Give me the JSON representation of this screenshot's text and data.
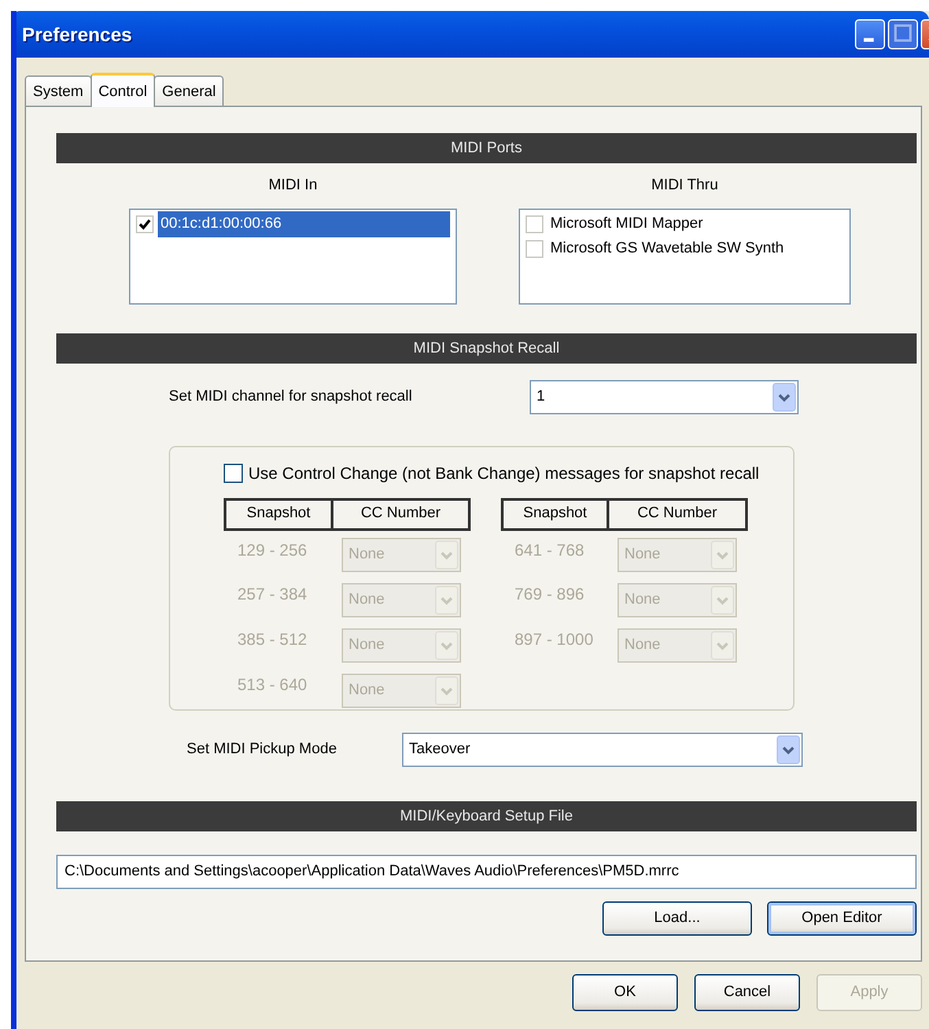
{
  "window": {
    "title": "Preferences"
  },
  "tabs": [
    {
      "label": "System",
      "selected": false
    },
    {
      "label": "Control",
      "selected": true
    },
    {
      "label": "General",
      "selected": false
    }
  ],
  "midi_ports": {
    "title": "MIDI Ports",
    "lists": [
      {
        "label": "MIDI In",
        "items": [
          {
            "label": "00:1c:d1:00:00:66",
            "checked": true,
            "selected": true
          }
        ]
      },
      {
        "label": "MIDI Thru",
        "items": [
          {
            "label": "Microsoft MIDI Mapper",
            "checked": false,
            "selected": false
          },
          {
            "label": "Microsoft GS Wavetable SW Synth",
            "checked": false,
            "selected": false
          }
        ]
      }
    ]
  },
  "snapshot_recall": {
    "title": "MIDI Snapshot Recall",
    "channel": {
      "label": "Set MIDI channel for snapshot recall",
      "value": "1"
    },
    "use_control_change": {
      "label": "Use Control Change (not Bank Change) messages for snapshot recall",
      "checked": false
    },
    "tables": [
      {
        "columns": [
          "Snapshot",
          "CC Number"
        ],
        "rows": [
          {
            "range": "129 - 256",
            "value": "None",
            "disabled": true
          },
          {
            "range": "257 - 384",
            "value": "None",
            "disabled": true
          },
          {
            "range": "385 - 512",
            "value": "None",
            "disabled": true
          },
          {
            "range": "513 - 640",
            "value": "None",
            "disabled": true
          }
        ]
      },
      {
        "columns": [
          "Snapshot",
          "CC Number"
        ],
        "rows": [
          {
            "range": "641 - 768",
            "value": "None",
            "disabled": true
          },
          {
            "range": "769 - 896",
            "value": "None",
            "disabled": true
          },
          {
            "range": "897 - 1000",
            "value": "None",
            "disabled": true
          }
        ]
      }
    ],
    "pickup": {
      "label": "Set MIDI Pickup Mode",
      "value": "Takeover"
    }
  },
  "setup_file": {
    "title": "MIDI/Keyboard Setup File",
    "path": "C:\\Documents and Settings\\acooper\\Application Data\\Waves Audio\\Preferences\\PM5D.mrrc",
    "buttons": [
      {
        "label": "Load...",
        "focused": false
      },
      {
        "label": "Open Editor",
        "focused": true
      }
    ]
  },
  "buttons": [
    {
      "label": "OK",
      "disabled": false
    },
    {
      "label": "Cancel",
      "disabled": false
    },
    {
      "label": "Apply",
      "disabled": true
    }
  ]
}
